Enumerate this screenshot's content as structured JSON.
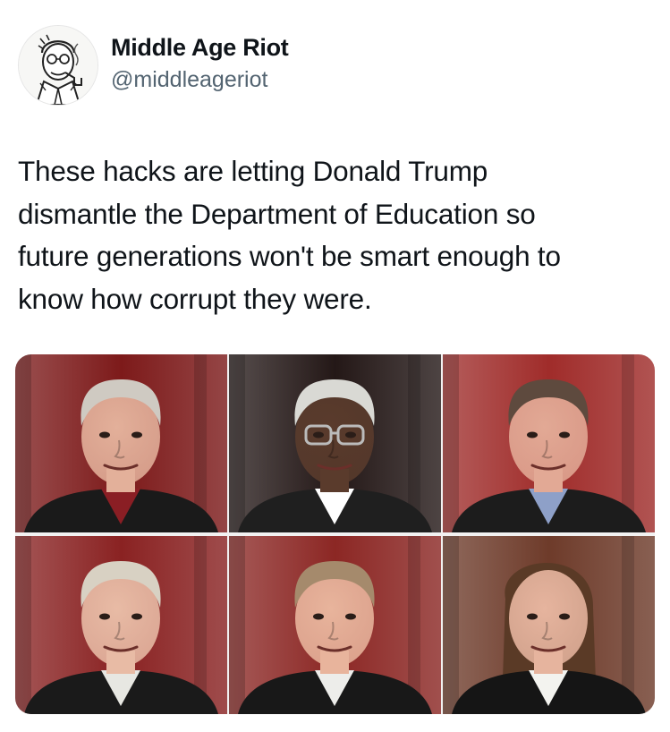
{
  "author": {
    "display_name": "Middle Age Riot",
    "handle": "@middleageriot",
    "avatar_icon": "cartoon-man-with-pipe-avatar"
  },
  "tweet": {
    "text": "These hacks are letting Donald Trump\ndismantle the Department of Education so\nfuture generations won't be smart enough to\nknow how corrupt they were."
  },
  "media": {
    "type": "photo-grid",
    "photos": [
      {
        "subject": "portrait-1",
        "skin": "#e3b09a",
        "hair": "#cfcac2",
        "robe": "#1a1a1a",
        "bg": "#7d1a1a",
        "tie": "#8a1e24"
      },
      {
        "subject": "portrait-2",
        "skin": "#5a3b2c",
        "hair": "#d9d9d4",
        "robe": "#1f1f1f",
        "bg": "#241817",
        "tie": "#ffffff"
      },
      {
        "subject": "portrait-3",
        "skin": "#e2a995",
        "hair": "#5e4a3e",
        "robe": "#1c1c1c",
        "bg": "#a02c2a",
        "tie": "#8ea0c8"
      },
      {
        "subject": "portrait-4",
        "skin": "#e8bba5",
        "hair": "#d8d1c3",
        "robe": "#1a1a1a",
        "bg": "#8a2222",
        "tie": "#e7e7e2"
      },
      {
        "subject": "portrait-5",
        "skin": "#e8b49c",
        "hair": "#a58a6c",
        "robe": "#181818",
        "bg": "#8c2724",
        "tie": "#ededea"
      },
      {
        "subject": "portrait-6",
        "skin": "#e6b49e",
        "hair": "#5a3a26",
        "robe": "#151515",
        "bg": "#6e3b2a",
        "tie": "#f3f3ef"
      }
    ]
  }
}
